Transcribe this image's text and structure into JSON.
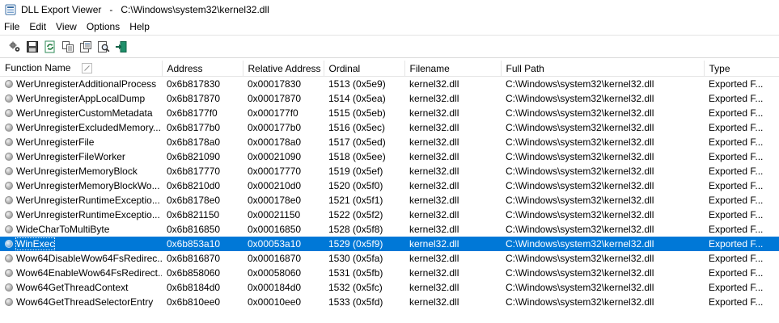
{
  "window": {
    "title": "DLL Export Viewer   -   C:\\Windows\\system32\\kernel32.dll",
    "icon": "app-icon"
  },
  "menu": [
    "File",
    "Edit",
    "View",
    "Options",
    "Help"
  ],
  "toolbar": [
    {
      "name": "properties-gear-icon"
    },
    {
      "name": "save-icon"
    },
    {
      "name": "refresh-icon"
    },
    {
      "name": "copy-icon"
    },
    {
      "name": "html-report-icon"
    },
    {
      "name": "find-icon"
    },
    {
      "name": "exit-icon"
    }
  ],
  "columns": [
    "Function Name",
    "Address",
    "Relative Address",
    "Ordinal",
    "Filename",
    "Full Path",
    "Type"
  ],
  "sort_column": "Function Name",
  "selected_row": 11,
  "colors": {
    "selection": "#0078d7",
    "grid_line": "#e5e5e5"
  },
  "rows": [
    {
      "function": "WerUnregisterAdditionalProcess",
      "address": "0x6b817830",
      "relative": "0x00017830",
      "ordinal": "1513 (0x5e9)",
      "filename": "kernel32.dll",
      "path": "C:\\Windows\\system32\\kernel32.dll",
      "type": "Exported F..."
    },
    {
      "function": "WerUnregisterAppLocalDump",
      "address": "0x6b817870",
      "relative": "0x00017870",
      "ordinal": "1514 (0x5ea)",
      "filename": "kernel32.dll",
      "path": "C:\\Windows\\system32\\kernel32.dll",
      "type": "Exported F..."
    },
    {
      "function": "WerUnregisterCustomMetadata",
      "address": "0x6b8177f0",
      "relative": "0x000177f0",
      "ordinal": "1515 (0x5eb)",
      "filename": "kernel32.dll",
      "path": "C:\\Windows\\system32\\kernel32.dll",
      "type": "Exported F..."
    },
    {
      "function": "WerUnregisterExcludedMemory...",
      "address": "0x6b8177b0",
      "relative": "0x000177b0",
      "ordinal": "1516 (0x5ec)",
      "filename": "kernel32.dll",
      "path": "C:\\Windows\\system32\\kernel32.dll",
      "type": "Exported F..."
    },
    {
      "function": "WerUnregisterFile",
      "address": "0x6b8178a0",
      "relative": "0x000178a0",
      "ordinal": "1517 (0x5ed)",
      "filename": "kernel32.dll",
      "path": "C:\\Windows\\system32\\kernel32.dll",
      "type": "Exported F..."
    },
    {
      "function": "WerUnregisterFileWorker",
      "address": "0x6b821090",
      "relative": "0x00021090",
      "ordinal": "1518 (0x5ee)",
      "filename": "kernel32.dll",
      "path": "C:\\Windows\\system32\\kernel32.dll",
      "type": "Exported F..."
    },
    {
      "function": "WerUnregisterMemoryBlock",
      "address": "0x6b817770",
      "relative": "0x00017770",
      "ordinal": "1519 (0x5ef)",
      "filename": "kernel32.dll",
      "path": "C:\\Windows\\system32\\kernel32.dll",
      "type": "Exported F..."
    },
    {
      "function": "WerUnregisterMemoryBlockWo...",
      "address": "0x6b8210d0",
      "relative": "0x000210d0",
      "ordinal": "1520 (0x5f0)",
      "filename": "kernel32.dll",
      "path": "C:\\Windows\\system32\\kernel32.dll",
      "type": "Exported F..."
    },
    {
      "function": "WerUnregisterRuntimeExceptio...",
      "address": "0x6b8178e0",
      "relative": "0x000178e0",
      "ordinal": "1521 (0x5f1)",
      "filename": "kernel32.dll",
      "path": "C:\\Windows\\system32\\kernel32.dll",
      "type": "Exported F..."
    },
    {
      "function": "WerUnregisterRuntimeExceptio...",
      "address": "0x6b821150",
      "relative": "0x00021150",
      "ordinal": "1522 (0x5f2)",
      "filename": "kernel32.dll",
      "path": "C:\\Windows\\system32\\kernel32.dll",
      "type": "Exported F..."
    },
    {
      "function": "WideCharToMultiByte",
      "address": "0x6b816850",
      "relative": "0x00016850",
      "ordinal": "1528 (0x5f8)",
      "filename": "kernel32.dll",
      "path": "C:\\Windows\\system32\\kernel32.dll",
      "type": "Exported F..."
    },
    {
      "function": "WinExec",
      "address": "0x6b853a10",
      "relative": "0x00053a10",
      "ordinal": "1529 (0x5f9)",
      "filename": "kernel32.dll",
      "path": "C:\\Windows\\system32\\kernel32.dll",
      "type": "Exported F..."
    },
    {
      "function": "Wow64DisableWow64FsRedirec...",
      "address": "0x6b816870",
      "relative": "0x00016870",
      "ordinal": "1530 (0x5fa)",
      "filename": "kernel32.dll",
      "path": "C:\\Windows\\system32\\kernel32.dll",
      "type": "Exported F..."
    },
    {
      "function": "Wow64EnableWow64FsRedirect...",
      "address": "0x6b858060",
      "relative": "0x00058060",
      "ordinal": "1531 (0x5fb)",
      "filename": "kernel32.dll",
      "path": "C:\\Windows\\system32\\kernel32.dll",
      "type": "Exported F..."
    },
    {
      "function": "Wow64GetThreadContext",
      "address": "0x6b8184d0",
      "relative": "0x000184d0",
      "ordinal": "1532 (0x5fc)",
      "filename": "kernel32.dll",
      "path": "C:\\Windows\\system32\\kernel32.dll",
      "type": "Exported F..."
    },
    {
      "function": "Wow64GetThreadSelectorEntry",
      "address": "0x6b810ee0",
      "relative": "0x00010ee0",
      "ordinal": "1533 (0x5fd)",
      "filename": "kernel32.dll",
      "path": "C:\\Windows\\system32\\kernel32.dll",
      "type": "Exported F..."
    }
  ]
}
